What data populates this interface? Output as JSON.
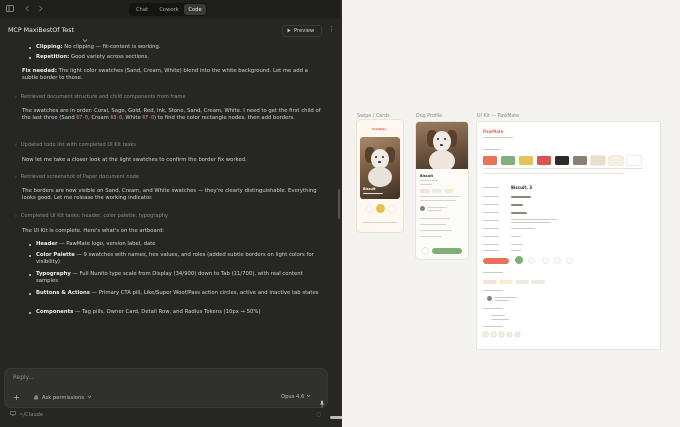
{
  "topbar": {
    "tabs": [
      "Chat",
      "Cowork",
      "Code"
    ],
    "active_tab": "Code"
  },
  "header": {
    "title": "MCP MaxiBestOf Test",
    "preview_label": "Preview"
  },
  "chat": {
    "bullets_top": [
      {
        "label": "Clipping:",
        "text": " No clipping — fit-content is working."
      },
      {
        "label": "Repetition:",
        "text": " Good variety across sections."
      }
    ],
    "fix_needed": {
      "label": "Fix needed:",
      "text": " The light color swatches (Sand, Cream, White) blend into the white background. Let me add a subtle border to those."
    },
    "tool1": "Retrieved document structure and child components from frame",
    "para1": {
      "a": "The swatches are in order: Coral, Sage, Gold, Red, Ink, Stone, Sand, Cream, White. I need to get the first child of the last three (Sand ",
      "c1": "67-0",
      "b": ", Cream ",
      "c2": "68-0",
      "c": ", White ",
      "c3": "6F-0",
      "d": ") to find the color rectangle nodes, then add borders."
    },
    "tool2": "Updated todo list with completed UI Kit tasks",
    "para2": "Now let me take a closer look at the light swatches to confirm the border fix worked.",
    "tool3": "Retrieved screenshot of Paper document node",
    "para3": "The borders are now visible on Sand, Cream, and White swatches — they're clearly distinguishable. Everything looks good. Let me release the working indicator.",
    "tool4": "Completed UI Kit tasks: header, color palette, typography",
    "para4": "The UI Kit is complete. Here's what's on the artboard:",
    "summary": [
      {
        "label": "Header",
        "text": " — PawMate logo, version label, date"
      },
      {
        "label": "Color Palette",
        "text": " — 9 swatches with names, hex values, and roles (added subtle borders on light colors for visibility)"
      },
      {
        "label": "Typography",
        "text": " — Full Nunito type scale from Display (34/900) down to Tab (11/700), with real content samples"
      },
      {
        "label": "Buttons & Actions",
        "text": " — Primary CTA pill, Like/Super Woof/Pass action circles, active and inactive tab states"
      },
      {
        "label": "Components",
        "text": " — Tag pills, Owner Card, Detail Row, and Radius Tokens (10px → 50%)"
      }
    ]
  },
  "composer": {
    "placeholder": "Reply...",
    "permissions": "Ask permissions",
    "model": "Opus 4.6"
  },
  "footer": {
    "path": "~/Claude"
  },
  "canvas": {
    "frames": [
      {
        "label": "Swipe / Cards"
      },
      {
        "label": "Dog Profile"
      },
      {
        "label": "UI Kit — PawMate"
      }
    ],
    "swipe_brand": "PawMate",
    "swipe_pet": "Biscuit",
    "profile_pet": "Biscuit",
    "kit_brand": "PawMate",
    "kit_heading": "Biscuit, 3",
    "swatches": [
      "#e8725a",
      "#7fb07a",
      "#e3c25a",
      "#d9534f",
      "#2d2a27",
      "#8a8175",
      "#eadfcd",
      "#f5efe4",
      "#ffffff"
    ]
  }
}
